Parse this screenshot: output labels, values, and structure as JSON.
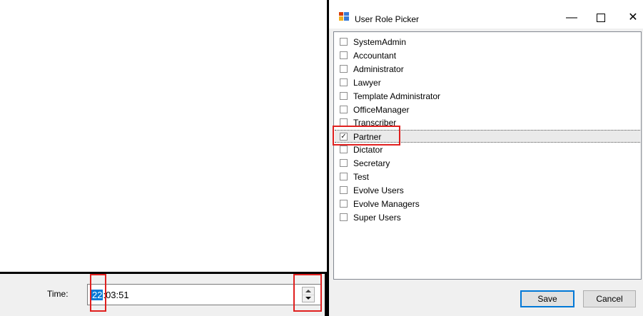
{
  "time_panel": {
    "label": "Time:",
    "hour": "22",
    "rest": ":03:51"
  },
  "dialog": {
    "title": "User Role Picker",
    "min_glyph": "—",
    "close_glyph": "✕",
    "roles": [
      {
        "label": "SystemAdmin",
        "checked": false
      },
      {
        "label": "Accountant",
        "checked": false
      },
      {
        "label": "Administrator",
        "checked": false
      },
      {
        "label": "Lawyer",
        "checked": false
      },
      {
        "label": "Template Administrator",
        "checked": false
      },
      {
        "label": "OfficeManager",
        "checked": false
      },
      {
        "label": "Transcriber",
        "checked": false
      },
      {
        "label": "Partner",
        "checked": true
      },
      {
        "label": "Dictator",
        "checked": false
      },
      {
        "label": "Secretary",
        "checked": false
      },
      {
        "label": "Test",
        "checked": false
      },
      {
        "label": "Evolve Users",
        "checked": false
      },
      {
        "label": "Evolve Managers",
        "checked": false
      },
      {
        "label": "Super Users",
        "checked": false
      }
    ],
    "save_label": "Save",
    "cancel_label": "Cancel"
  },
  "colors": {
    "highlight_box": "#e0201f",
    "selection": "#0078d7"
  }
}
